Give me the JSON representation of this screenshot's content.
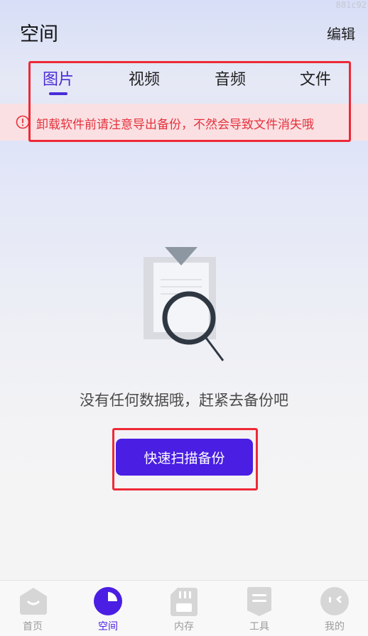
{
  "watermark": "881c92",
  "header": {
    "title": "空间",
    "edit_label": "编辑"
  },
  "tabs": [
    {
      "label": "图片",
      "active": true
    },
    {
      "label": "视频",
      "active": false
    },
    {
      "label": "音频",
      "active": false
    },
    {
      "label": "文件",
      "active": false
    }
  ],
  "notice": {
    "text": "卸载软件前请注意导出备份，不然会导致文件消失哦",
    "icon": "alert-circle-icon",
    "color": "#e4323c"
  },
  "empty_state": {
    "icon": "document-search-icon",
    "message": "没有任何数据哦，赶紧去备份吧",
    "button_label": "快速扫描备份"
  },
  "bottom_nav": [
    {
      "label": "首页",
      "icon": "home-icon",
      "active": false
    },
    {
      "label": "空间",
      "icon": "pie-chart-icon",
      "active": true
    },
    {
      "label": "内存",
      "icon": "sd-card-icon",
      "active": false
    },
    {
      "label": "工具",
      "icon": "toolbox-icon",
      "active": false
    },
    {
      "label": "我的",
      "icon": "profile-face-icon",
      "active": false
    }
  ],
  "colors": {
    "accent": "#4a1ee3",
    "warning": "#e4323c",
    "highlight_box": "#ee2936"
  }
}
